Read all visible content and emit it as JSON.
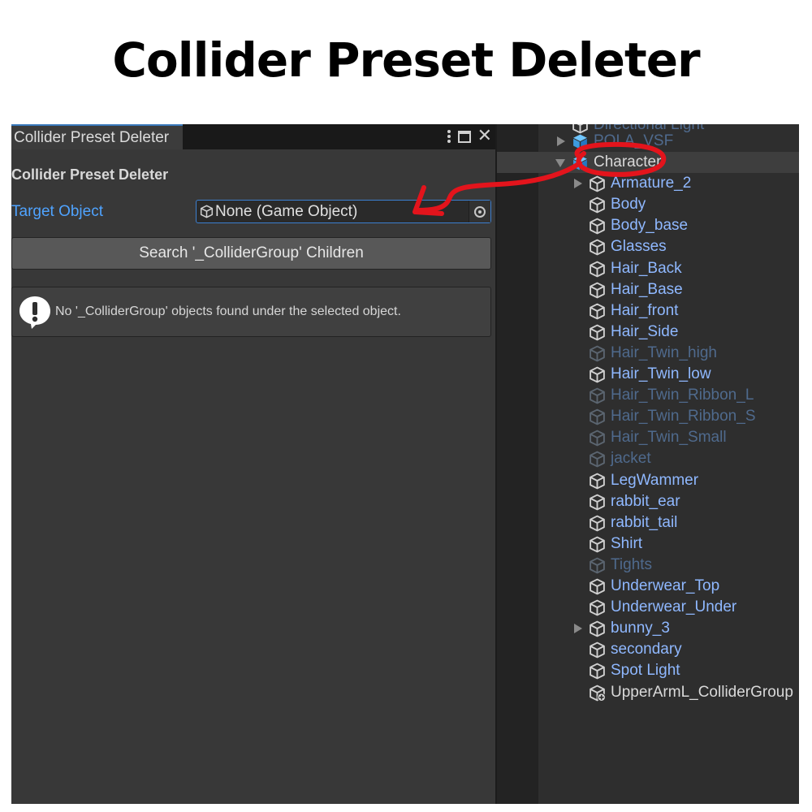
{
  "headline": "Collider Preset Deleter",
  "editor": {
    "tab_label": "Collider Preset Deleter",
    "window_title": "Collider Preset Deleter",
    "target_label": "Target Object",
    "target_value": "None (Game Object)",
    "search_button": "Search '_ColliderGroup' Children",
    "help_message": "No '_ColliderGroup' objects found under the selected object."
  },
  "hierarchy": {
    "items": [
      {
        "label": "Directional Light",
        "state": "cut"
      },
      {
        "label": "POLA_VSF",
        "state": "faded",
        "prefab": true,
        "arrow": true
      },
      {
        "label": "Character",
        "state": "selected",
        "prefab": true,
        "arrow": "open"
      },
      {
        "label": "Armature_2",
        "state": "normal",
        "arrow": true
      },
      {
        "label": "Body",
        "state": "normal"
      },
      {
        "label": "Body_base",
        "state": "normal"
      },
      {
        "label": "Glasses",
        "state": "normal"
      },
      {
        "label": "Hair_Back",
        "state": "normal"
      },
      {
        "label": "Hair_Base",
        "state": "normal"
      },
      {
        "label": "Hair_front",
        "state": "normal"
      },
      {
        "label": "Hair_Side",
        "state": "normal"
      },
      {
        "label": "Hair_Twin_high",
        "state": "disabled"
      },
      {
        "label": "Hair_Twin_low",
        "state": "normal"
      },
      {
        "label": "Hair_Twin_Ribbon_L",
        "state": "disabled"
      },
      {
        "label": "Hair_Twin_Ribbon_S",
        "state": "disabled"
      },
      {
        "label": "Hair_Twin_Small",
        "state": "disabled"
      },
      {
        "label": "jacket",
        "state": "disabled"
      },
      {
        "label": "LegWammer",
        "state": "normal"
      },
      {
        "label": "rabbit_ear",
        "state": "normal"
      },
      {
        "label": "rabbit_tail",
        "state": "normal"
      },
      {
        "label": "Shirt",
        "state": "normal"
      },
      {
        "label": "Tights",
        "state": "disabled"
      },
      {
        "label": "Underwear_Top",
        "state": "normal"
      },
      {
        "label": "Underwear_Under",
        "state": "normal"
      },
      {
        "label": "bunny_3",
        "state": "normal",
        "arrow": true
      },
      {
        "label": "secondary",
        "state": "normal"
      },
      {
        "label": "Spot Light",
        "state": "normal"
      },
      {
        "label": "UpperArmL_ColliderGroup",
        "state": "added"
      }
    ]
  },
  "colors": {
    "prefab_text": "#8fb8ff",
    "disabled_text": "#4f6a8d",
    "plain_text": "#d9d9d9",
    "accent": "#3c7fd0",
    "annotation": "#e3141c"
  }
}
